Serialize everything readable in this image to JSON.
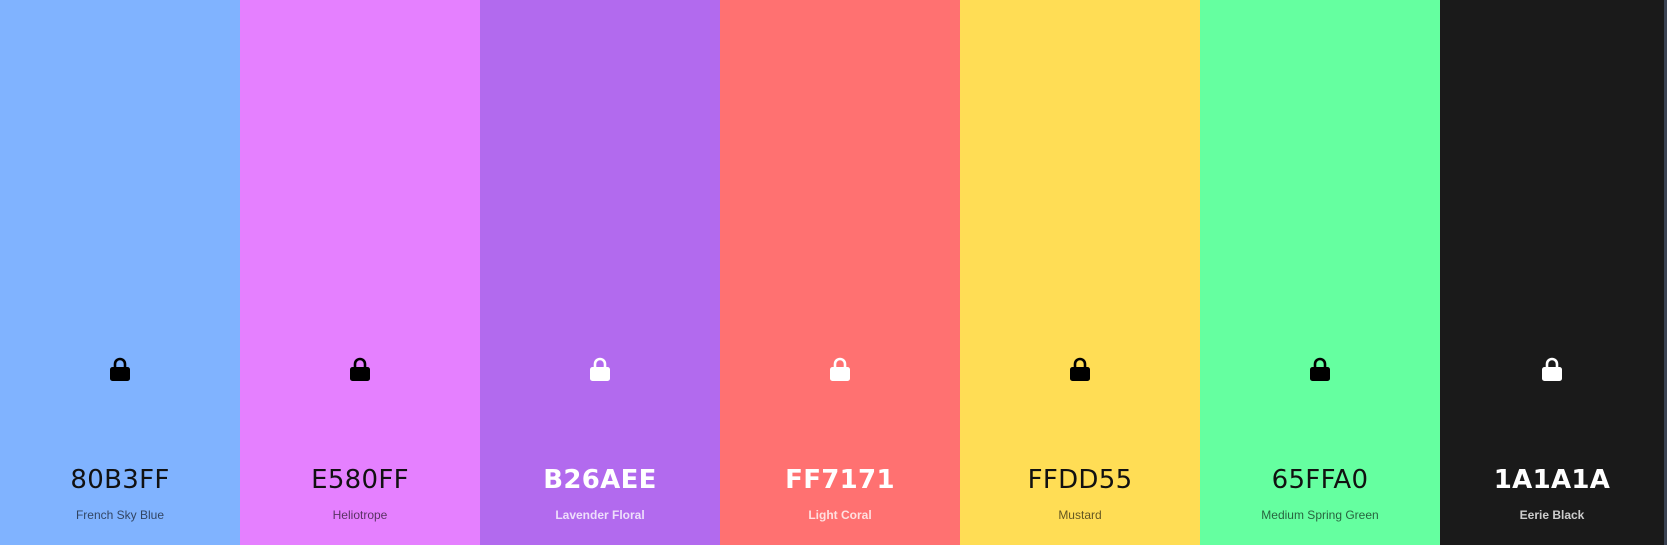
{
  "palette": {
    "colors": [
      {
        "hex": "80B3FF",
        "name": "French Sky Blue",
        "color": "#80B3FF",
        "lock_icon": "lock-icon",
        "lock_color": "#000000"
      },
      {
        "hex": "E580FF",
        "name": "Heliotrope",
        "color": "#E580FF",
        "lock_icon": "lock-icon",
        "lock_color": "#000000"
      },
      {
        "hex": "B26AEE",
        "name": "Lavender Floral",
        "color": "#B26AEE",
        "lock_icon": "lock-icon",
        "lock_color": "#FFFFFF"
      },
      {
        "hex": "FF7171",
        "name": "Light Coral",
        "color": "#FF7171",
        "lock_icon": "lock-icon",
        "lock_color": "#FFFFFF"
      },
      {
        "hex": "FFDD55",
        "name": "Mustard",
        "color": "#FFDD55",
        "lock_icon": "lock-icon",
        "lock_color": "#000000"
      },
      {
        "hex": "65FFA0",
        "name": "Medium Spring Green",
        "color": "#65FFA0",
        "lock_icon": "lock-icon",
        "lock_color": "#000000"
      },
      {
        "hex": "1A1A1A",
        "name": "Eerie Black",
        "color": "#1A1A1A",
        "lock_icon": "lock-icon",
        "lock_color": "#FFFFFF"
      }
    ]
  }
}
